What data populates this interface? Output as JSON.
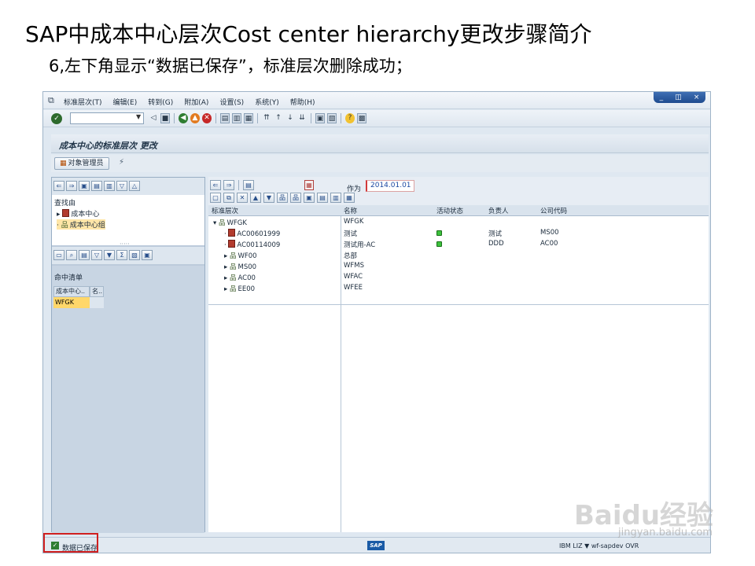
{
  "slide": {
    "title": "SAP中成本中心层次Cost center hierarchy更改步骤简介",
    "subtitle": "6,左下角显示“数据已保存”，标准层次删除成功；"
  },
  "menubar": {
    "items": [
      "标准层次(T)",
      "编辑(E)",
      "转到(G)",
      "附加(A)",
      "设置(S)",
      "系统(Y)",
      "帮助(H)"
    ]
  },
  "window_controls": {
    "minimize": "_",
    "restore": "◫",
    "close": "×"
  },
  "toolbar": {
    "command_value": ""
  },
  "screen": {
    "title": "成本中心的标准层次 更改",
    "object_manager_label": "对象管理员"
  },
  "left_pane": {
    "search_label": "查找由",
    "search_items": [
      "成本中心",
      "成本中心组"
    ],
    "hit_list_label": "命中清单",
    "hit_columns": [
      "成本中心..",
      "名.."
    ],
    "hit_rows": [
      {
        "c1": "WFGK",
        "c2": ""
      }
    ]
  },
  "right_pane": {
    "as_of_label": "作为",
    "as_of_value": "2014.01.01",
    "columns": [
      "标准层次",
      "名称",
      "活动状态",
      "负责人",
      "公司代码"
    ],
    "rows": [
      {
        "node": "WFGK",
        "name": "WFGK",
        "responsible": "",
        "company": ""
      },
      {
        "node": "AC00601999",
        "name": "测试",
        "responsible": "测试",
        "company": "MS00"
      },
      {
        "node": "AC00114009",
        "name": "测试用-AC",
        "responsible": "DDD",
        "company": "AC00"
      },
      {
        "node": "WF00",
        "name": "总部",
        "responsible": "",
        "company": ""
      },
      {
        "node": "MS00",
        "name": "WFMS",
        "responsible": "",
        "company": ""
      },
      {
        "node": "AC00",
        "name": "WFAC",
        "responsible": "",
        "company": ""
      },
      {
        "node": "EE00",
        "name": "WFEE",
        "responsible": "",
        "company": ""
      }
    ]
  },
  "statusbar": {
    "message": "数据已保存",
    "sap_logo": "SAP",
    "system_info": "IBM LIZ ▼  wf-sapdev  OVR"
  },
  "watermark": {
    "brand": "Baidu经验",
    "url": "jingyan.baidu.com"
  }
}
